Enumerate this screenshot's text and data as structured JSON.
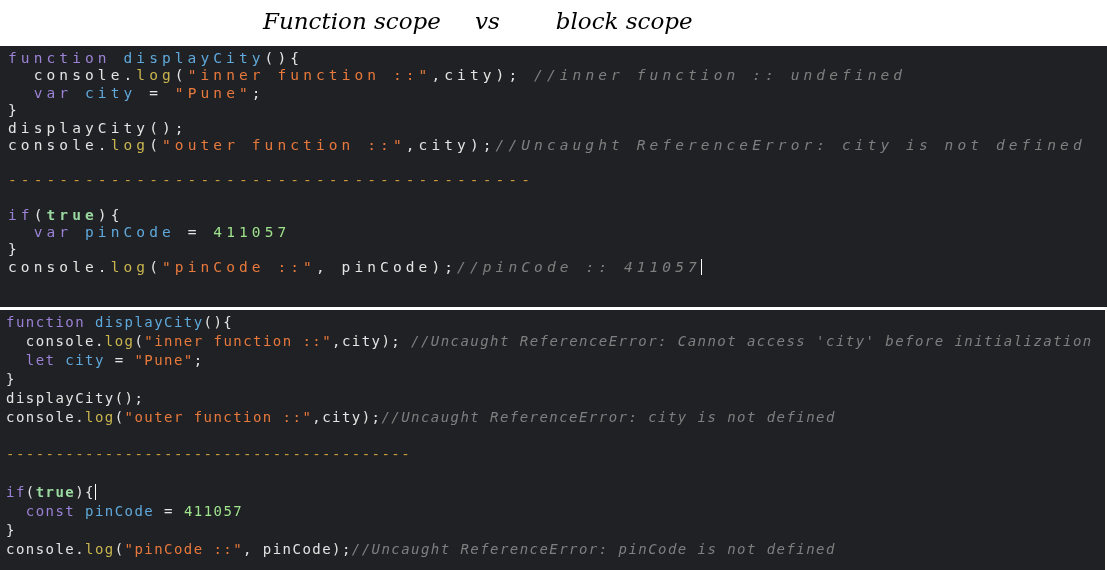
{
  "title": [
    "Function scope",
    "vs",
    "block scope"
  ],
  "panels": [
    {
      "lines": [
        {
          "tokens": [
            {
              "kind": "keyword",
              "text": "function "
            },
            {
              "kind": "name",
              "text": "displayCity"
            },
            {
              "kind": "plain",
              "text": "(){"
            }
          ]
        },
        {
          "indented": true,
          "tokens": [
            {
              "kind": "plain",
              "text": "console."
            },
            {
              "kind": "method",
              "text": "log"
            },
            {
              "kind": "plain",
              "text": "("
            },
            {
              "kind": "string",
              "text": "\"inner function ::\""
            },
            {
              "kind": "plain",
              "text": ",city); "
            },
            {
              "kind": "comment",
              "text": "//inner function :: undefined"
            }
          ]
        },
        {
          "indented": true,
          "tokens": [
            {
              "kind": "keyword",
              "text": "var "
            },
            {
              "kind": "name",
              "text": "city"
            },
            {
              "kind": "plain",
              "text": " = "
            },
            {
              "kind": "string",
              "text": "\"Pune\""
            },
            {
              "kind": "plain",
              "text": ";"
            }
          ]
        },
        {
          "tokens": [
            {
              "kind": "plain",
              "text": "}"
            }
          ]
        },
        {
          "tokens": [
            {
              "kind": "plain",
              "text": "displayCity();"
            }
          ]
        },
        {
          "tokens": [
            {
              "kind": "plain",
              "text": "console."
            },
            {
              "kind": "method",
              "text": "log"
            },
            {
              "kind": "plain",
              "text": "("
            },
            {
              "kind": "string",
              "text": "\"outer function ::\""
            },
            {
              "kind": "plain",
              "text": ",city);"
            },
            {
              "kind": "comment",
              "text": "//Uncaught ReferenceError: city is not defined"
            }
          ]
        },
        {
          "blank": true
        },
        {
          "tokens": [
            {
              "kind": "rule",
              "text": "-----------------------------------------"
            }
          ]
        },
        {
          "blank": true
        },
        {
          "tokens": [
            {
              "kind": "keyword",
              "text": "if"
            },
            {
              "kind": "plain",
              "text": "("
            },
            {
              "kind": "literal",
              "text": "true"
            },
            {
              "kind": "plain",
              "text": "){"
            }
          ]
        },
        {
          "indented": true,
          "tokens": [
            {
              "kind": "keyword",
              "text": "var "
            },
            {
              "kind": "name",
              "text": "pinCode"
            },
            {
              "kind": "plain",
              "text": " = "
            },
            {
              "kind": "number",
              "text": "411057"
            }
          ]
        },
        {
          "tokens": [
            {
              "kind": "plain",
              "text": "}"
            }
          ]
        },
        {
          "tokens": [
            {
              "kind": "plain",
              "text": "console."
            },
            {
              "kind": "method",
              "text": "log"
            },
            {
              "kind": "plain",
              "text": "("
            },
            {
              "kind": "string",
              "text": "\"pinCode ::\""
            },
            {
              "kind": "plain",
              "text": ", pinCode);"
            },
            {
              "kind": "comment",
              "text": "//pinCode :: 411057",
              "caret": true
            }
          ]
        }
      ]
    },
    {
      "lines": [
        {
          "tokens": [
            {
              "kind": "keyword",
              "text": "function "
            },
            {
              "kind": "name",
              "text": "displayCity"
            },
            {
              "kind": "plain",
              "text": "(){"
            }
          ]
        },
        {
          "indented": true,
          "tokens": [
            {
              "kind": "plain",
              "text": "console."
            },
            {
              "kind": "method",
              "text": "log"
            },
            {
              "kind": "plain",
              "text": "("
            },
            {
              "kind": "string",
              "text": "\"inner function ::\""
            },
            {
              "kind": "plain",
              "text": ",city); "
            },
            {
              "kind": "comment",
              "text": "//Uncaught ReferenceError: Cannot access 'city' before initialization"
            }
          ]
        },
        {
          "indented": true,
          "tokens": [
            {
              "kind": "keyword",
              "text": "let "
            },
            {
              "kind": "name",
              "text": "city"
            },
            {
              "kind": "plain",
              "text": " = "
            },
            {
              "kind": "string",
              "text": "\"Pune\""
            },
            {
              "kind": "plain",
              "text": ";"
            }
          ]
        },
        {
          "tokens": [
            {
              "kind": "plain",
              "text": "}"
            }
          ]
        },
        {
          "tokens": [
            {
              "kind": "plain",
              "text": "displayCity();"
            }
          ]
        },
        {
          "tokens": [
            {
              "kind": "plain",
              "text": "console."
            },
            {
              "kind": "method",
              "text": "log"
            },
            {
              "kind": "plain",
              "text": "("
            },
            {
              "kind": "string",
              "text": "\"outer function ::\""
            },
            {
              "kind": "plain",
              "text": ",city);"
            },
            {
              "kind": "comment",
              "text": "//Uncaught ReferenceError: city is not defined"
            }
          ]
        },
        {
          "blank": true
        },
        {
          "tokens": [
            {
              "kind": "rule",
              "text": "-----------------------------------------"
            }
          ]
        },
        {
          "blank": true
        },
        {
          "tokens": [
            {
              "kind": "keyword",
              "text": "if"
            },
            {
              "kind": "plain",
              "text": "("
            },
            {
              "kind": "literal",
              "text": "true"
            },
            {
              "kind": "plain",
              "text": "){",
              "caret": true
            }
          ]
        },
        {
          "indented": true,
          "tokens": [
            {
              "kind": "keyword",
              "text": "const "
            },
            {
              "kind": "name",
              "text": "pinCode"
            },
            {
              "kind": "plain",
              "text": " = "
            },
            {
              "kind": "number",
              "text": "411057"
            }
          ]
        },
        {
          "tokens": [
            {
              "kind": "plain",
              "text": "}"
            }
          ]
        },
        {
          "tokens": [
            {
              "kind": "plain",
              "text": "console."
            },
            {
              "kind": "method",
              "text": "log"
            },
            {
              "kind": "plain",
              "text": "("
            },
            {
              "kind": "string",
              "text": "\"pinCode ::\""
            },
            {
              "kind": "plain",
              "text": ", pinCode);"
            },
            {
              "kind": "comment",
              "text": "//Uncaught ReferenceError: pinCode is not defined"
            }
          ]
        }
      ]
    }
  ]
}
